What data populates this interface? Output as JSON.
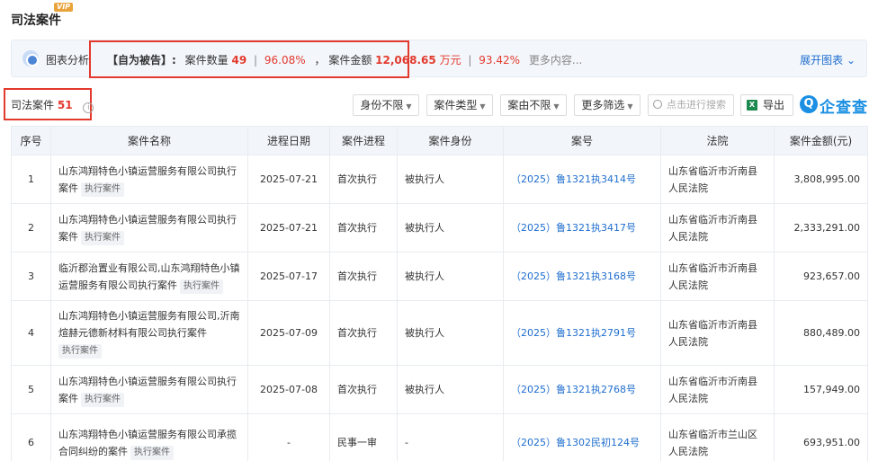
{
  "header": {
    "title": "司法案件",
    "vip": "VIP"
  },
  "analysis": {
    "label": "图表分析",
    "role": "【自为被告】:",
    "count_label": "案件数量",
    "count_value": "49",
    "count_pct": "96.08%",
    "sep": "，",
    "amount_label": "案件金额",
    "amount_value": "12,068.65",
    "amount_unit": "万元",
    "amount_pct": "93.42%",
    "more": "更多内容...",
    "expand": "展开图表"
  },
  "cases": {
    "label": "司法案件",
    "count": "51"
  },
  "filters": {
    "identity": "身份不限",
    "type": "案件类型",
    "reason": "案由不限",
    "more": "更多筛选",
    "search_placeholder": "点击进行搜索",
    "export": "导出",
    "brand": "企查查"
  },
  "table": {
    "headers": [
      "序号",
      "案件名称",
      "进程日期",
      "案件进程",
      "案件身份",
      "案号",
      "法院",
      "案件金额(元)"
    ],
    "rows": [
      {
        "no": "1",
        "name": "山东鸿翔特色小镇运营服务有限公司执行案件",
        "tag": "执行案件",
        "date": "2025-07-21",
        "progress": "首次执行",
        "role": "被执行人",
        "case_no": "（2025）鲁1321执3414号",
        "court": "山东省临沂市沂南县人民法院",
        "amount": "3,808,995.00"
      },
      {
        "no": "2",
        "name": "山东鸿翔特色小镇运营服务有限公司执行案件",
        "tag": "执行案件",
        "date": "2025-07-21",
        "progress": "首次执行",
        "role": "被执行人",
        "case_no": "（2025）鲁1321执3417号",
        "court": "山东省临沂市沂南县人民法院",
        "amount": "2,333,291.00"
      },
      {
        "no": "3",
        "name": "临沂郡治置业有限公司,山东鸿翔特色小镇运营服务有限公司执行案件",
        "tag": "执行案件",
        "date": "2025-07-17",
        "progress": "首次执行",
        "role": "被执行人",
        "case_no": "（2025）鲁1321执3168号",
        "court": "山东省临沂市沂南县人民法院",
        "amount": "923,657.00"
      },
      {
        "no": "4",
        "name": "山东鸿翔特色小镇运营服务有限公司,沂南煊赫元德新材料有限公司执行案件",
        "tag": "执行案件",
        "date": "2025-07-09",
        "progress": "首次执行",
        "role": "被执行人",
        "case_no": "（2025）鲁1321执2791号",
        "court": "山东省临沂市沂南县人民法院",
        "amount": "880,489.00"
      },
      {
        "no": "5",
        "name": "山东鸿翔特色小镇运营服务有限公司执行案件",
        "tag": "执行案件",
        "date": "2025-07-08",
        "progress": "首次执行",
        "role": "被执行人",
        "case_no": "（2025）鲁1321执2768号",
        "court": "山东省临沂市沂南县人民法院",
        "amount": "157,949.00"
      },
      {
        "no": "6",
        "name": "山东鸿翔特色小镇运营服务有限公司承揽合同纠纷的案件",
        "tag": "执行案件",
        "date": "-",
        "progress": "民事一审",
        "role": "-",
        "case_no": "（2025）鲁1302民初124号",
        "court": "山东省临沂市兰山区人民法院",
        "amount": "693,951.00"
      }
    ]
  }
}
